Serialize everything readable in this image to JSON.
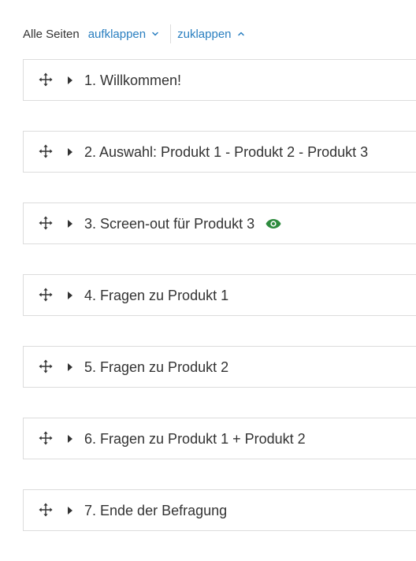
{
  "toolbar": {
    "label": "Alle Seiten",
    "expand_label": "aufklappen",
    "collapse_label": "zuklappen"
  },
  "pages": [
    {
      "title": "1. Willkommen!",
      "has_visibility_icon": false
    },
    {
      "title": "2. Auswahl: Produkt 1 - Produkt 2 - Produkt 3",
      "has_visibility_icon": false
    },
    {
      "title": "3. Screen-out für Produkt 3",
      "has_visibility_icon": true
    },
    {
      "title": "4. Fragen zu Produkt 1",
      "has_visibility_icon": false
    },
    {
      "title": "5. Fragen zu Produkt 2",
      "has_visibility_icon": false
    },
    {
      "title": "6. Fragen zu Produkt 1 + Produkt 2",
      "has_visibility_icon": false
    },
    {
      "title": "7. Ende der Befragung",
      "has_visibility_icon": false
    }
  ],
  "icons": {
    "drag": "move-arrows-icon",
    "expand": "caret-right-icon",
    "visibility": "eye-icon",
    "chevron_down": "chevron-down-icon",
    "chevron_up": "chevron-up-icon"
  },
  "colors": {
    "link": "#2a7fc0",
    "eye": "#2e8b3e",
    "text": "#333333",
    "border": "#dcdcdc"
  }
}
